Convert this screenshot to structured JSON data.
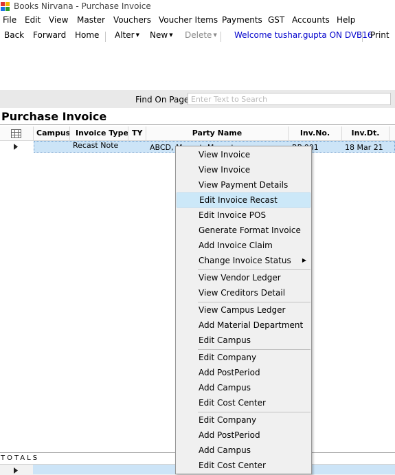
{
  "window": {
    "title": "Books Nirvana - Purchase Invoice"
  },
  "menubar": {
    "items": [
      "File",
      "Edit",
      "View",
      "Master",
      "Vouchers",
      "Voucher Items",
      "Payments",
      "GST",
      "Accounts",
      "Help"
    ]
  },
  "toolbar": {
    "back": "Back",
    "forward": "Forward",
    "home": "Home",
    "alter": "Alter",
    "new": "New",
    "delete": "Delete",
    "welcome": "Welcome tushar.gupta ON DVB16",
    "print": "Print"
  },
  "find": {
    "label": "Find On Page",
    "placeholder": "Enter Text to Search",
    "value": ""
  },
  "page": {
    "title": "Purchase Invoice"
  },
  "grid": {
    "columns": [
      "Campus",
      "Invoice Type",
      "TY",
      "Party Name",
      "Inv.No.",
      "Inv.Dt."
    ],
    "row": {
      "campus": "",
      "invoice_type": "Recast Note",
      "ty": "",
      "party_name": "ABCD, Meerut, Meerut",
      "inv_no": "RP 001",
      "inv_dt": "18 Mar 21"
    }
  },
  "totals": {
    "label": "TOTALS"
  },
  "context_menu": {
    "groups": [
      [
        "View Invoice",
        "View Invoice",
        "View Payment Details",
        "Edit Invoice Recast",
        "Edit Invoice POS",
        "Generate Format Invoice",
        "Add Invoice Claim",
        "Change Invoice Status"
      ],
      [
        "View Vendor Ledger",
        "View Creditors Detail"
      ],
      [
        "View Campus Ledger",
        "Add Material Department",
        "Edit Campus"
      ],
      [
        "Edit Company",
        "Add PostPeriod",
        "Add Campus",
        "Edit Cost Center"
      ],
      [
        "Edit Company",
        "Add PostPeriod",
        "Add Campus",
        "Edit Cost Center"
      ]
    ],
    "highlighted": "Edit Invoice Recast",
    "submenu_item": "Change Invoice Status"
  },
  "colors": {
    "selection": "#cce4f7",
    "menu_highlight": "#cce8f8",
    "welcome_link": "#0000cc"
  }
}
